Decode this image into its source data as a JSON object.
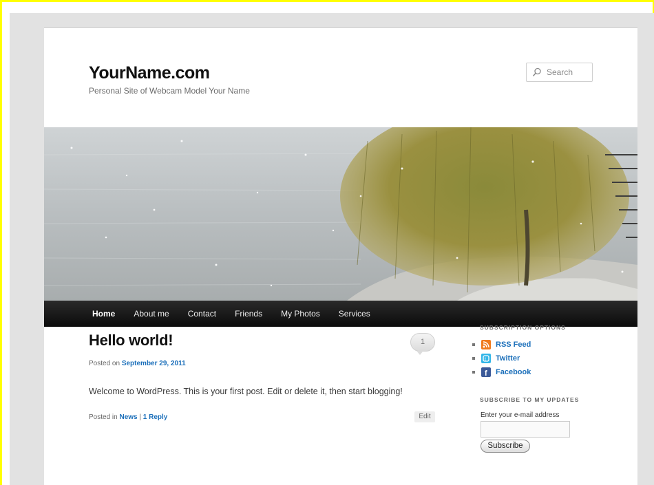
{
  "site": {
    "title": "YourName.com",
    "description": "Personal Site of Webcam Model Your Name"
  },
  "search": {
    "placeholder": "Search"
  },
  "nav": {
    "items": [
      "Home",
      "About me",
      "Contact",
      "Friends",
      "My Photos",
      "Services"
    ],
    "current": "Home"
  },
  "post": {
    "title": "Hello world!",
    "comment_count": "1",
    "posted_on_prefix": "Posted on",
    "date": "September 29, 2011",
    "content": "Welcome to WordPress. This is your first post. Edit or delete it, then start blogging!",
    "posted_in_prefix": "Posted in",
    "category": "News",
    "separator": "|",
    "replies": "1 Reply",
    "edit_label": "Edit"
  },
  "sidebar": {
    "subscription_title": "SUBSCRIPTION OPTIONS",
    "subscription_items": [
      {
        "label": "RSS Feed",
        "icon": "rss-icon",
        "color": "#f07a1c"
      },
      {
        "label": "Twitter",
        "icon": "twitter-icon",
        "color": "#33b6e8"
      },
      {
        "label": "Facebook",
        "icon": "facebook-icon",
        "color": "#3b5998"
      }
    ],
    "updates_title": "SUBSCRIBE TO MY UPDATES",
    "email_label": "Enter your e-mail address",
    "subscribe_label": "Subscribe"
  },
  "colors": {
    "highlight_border": "#ffff00",
    "link": "#1b6fba",
    "nav_bg": "#111111"
  }
}
